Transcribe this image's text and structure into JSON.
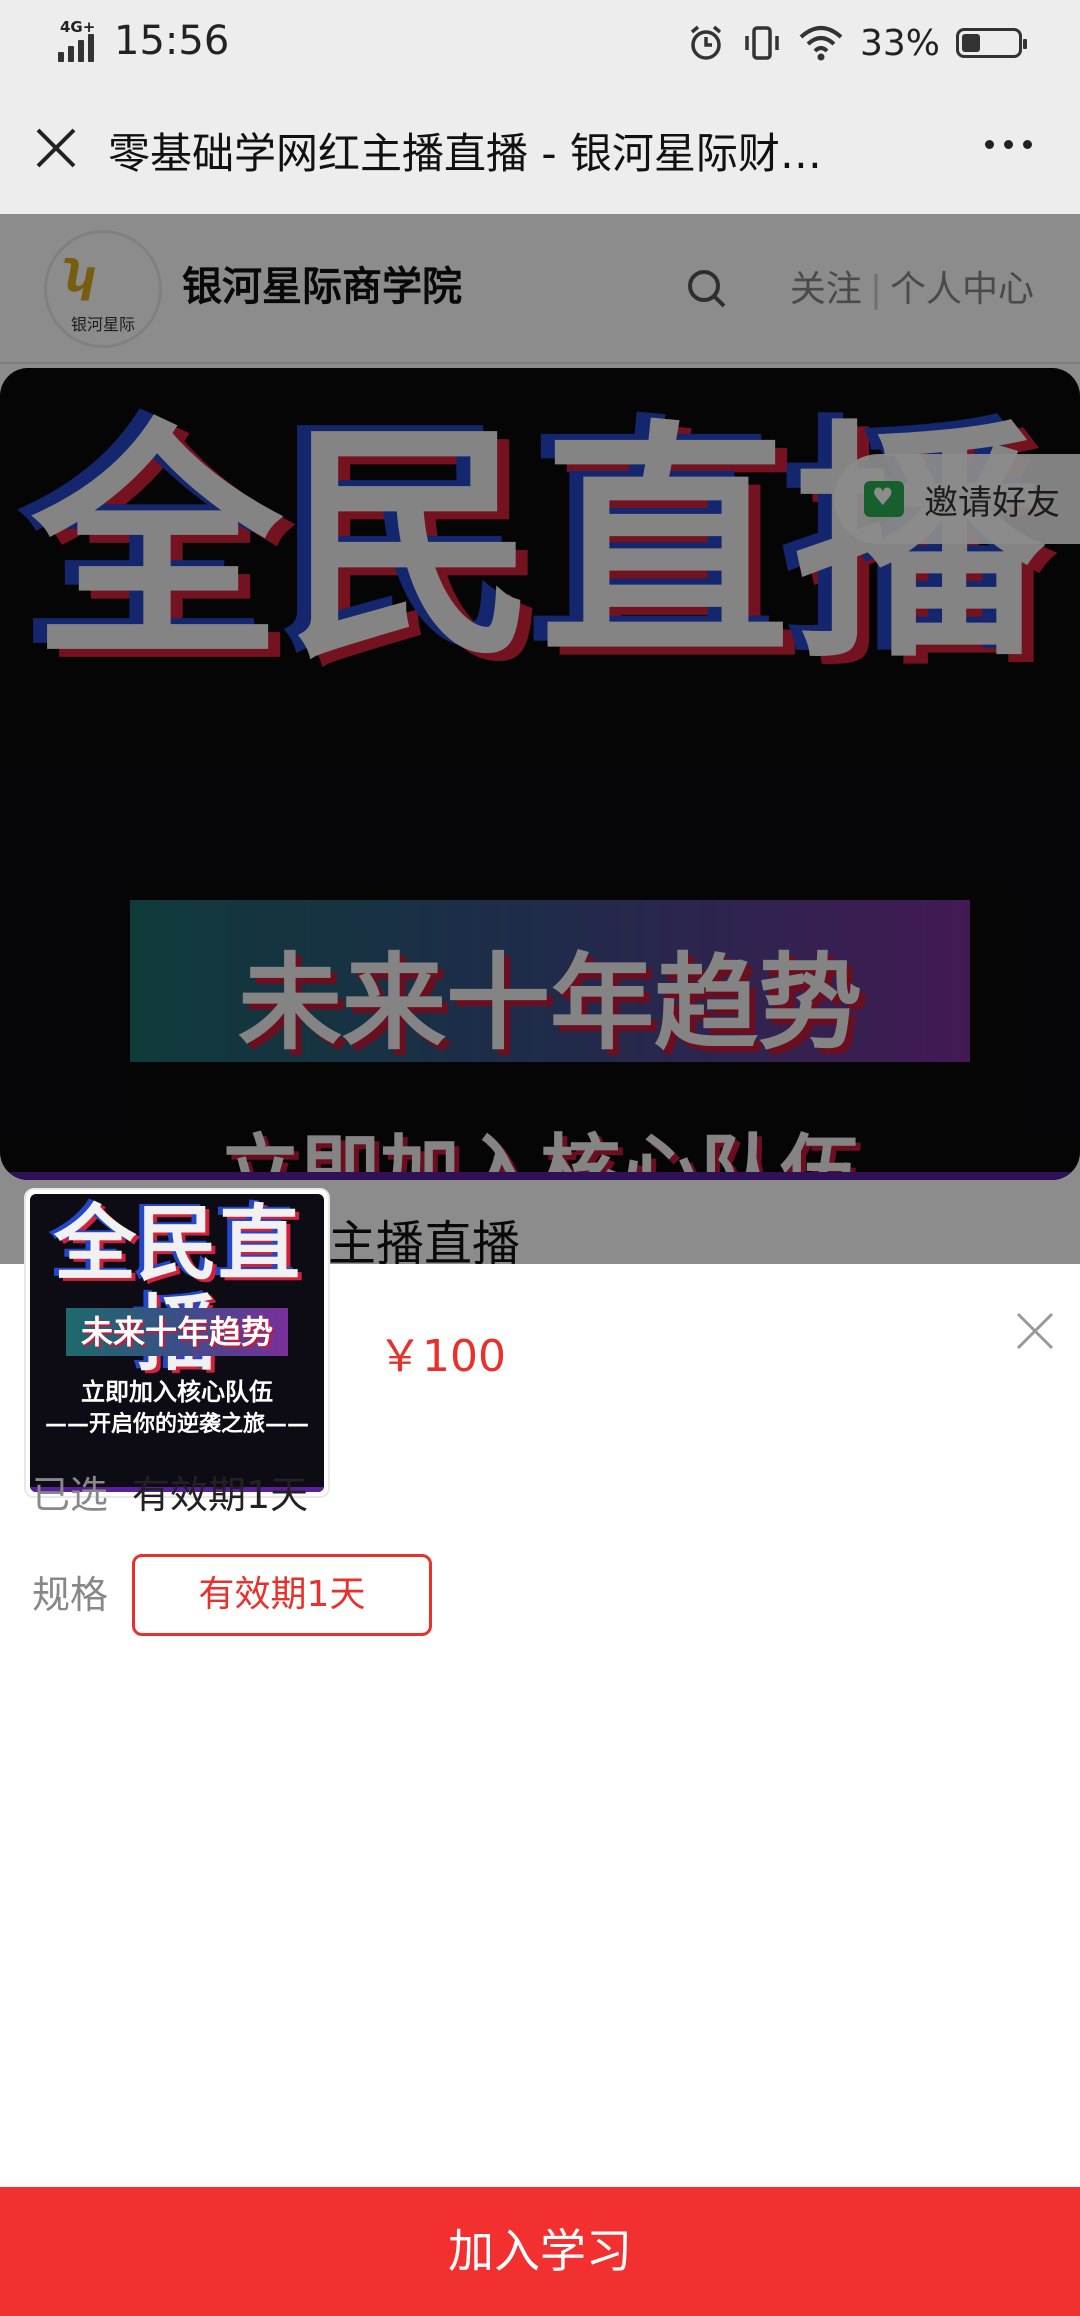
{
  "status_bar": {
    "network": "4G+",
    "time": "15:56",
    "battery_percent": "33%",
    "battery_level": 0.33
  },
  "nav": {
    "title": "零基础学网红主播直播 - 银河星际财…",
    "close_icon": "close-icon",
    "more_icon": "more-icon"
  },
  "site": {
    "name": "银河星际商学院",
    "logo_text": "银河星际",
    "follow": "关注",
    "separator": "|",
    "profile": "个人中心"
  },
  "banner": {
    "hero": "全民直播",
    "strip": "未来十年趋势",
    "line1": "立即加入核心队伍",
    "line2": "——开启你的逆袭之旅——"
  },
  "invite": {
    "label": "邀请好友"
  },
  "course": {
    "title_visible": "零基础学网红主播直播"
  },
  "sheet": {
    "price": "￥100",
    "selected_label": "已选",
    "selected_value": "有效期1天",
    "spec_label": "规格",
    "spec_option": "有效期1天"
  },
  "cta": {
    "label": "加入学习"
  },
  "colors": {
    "accent": "#e8312c",
    "cta_bg": "#f23030",
    "bar_bg": "#ededed"
  }
}
